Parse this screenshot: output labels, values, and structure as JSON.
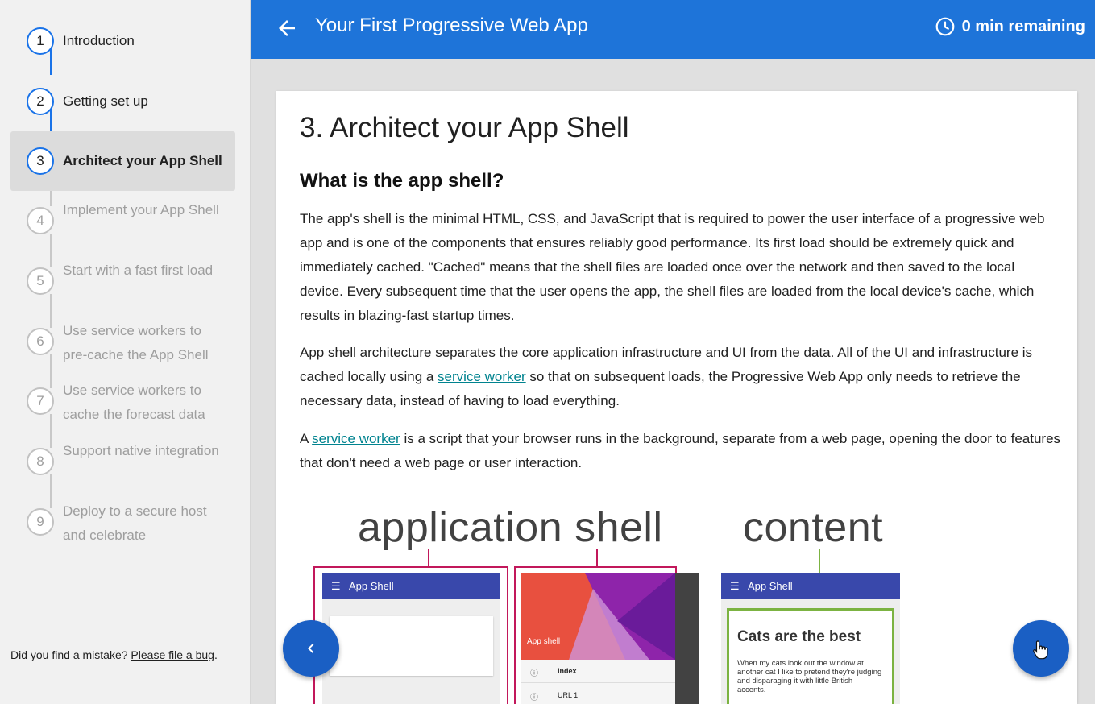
{
  "sidebar": {
    "steps": [
      {
        "num": "1",
        "label": "Introduction",
        "state": "done"
      },
      {
        "num": "2",
        "label": "Getting set up",
        "state": "done"
      },
      {
        "num": "3",
        "label": "Architect your App Shell",
        "state": "active"
      },
      {
        "num": "4",
        "label": "Implement your App Shell",
        "state": "todo"
      },
      {
        "num": "5",
        "label": "Start with a fast first load",
        "state": "todo"
      },
      {
        "num": "6",
        "label": "Use service workers to pre-cache the App Shell",
        "state": "todo"
      },
      {
        "num": "7",
        "label": "Use service workers to cache the forecast data",
        "state": "todo"
      },
      {
        "num": "8",
        "label": "Support native integration",
        "state": "todo"
      },
      {
        "num": "9",
        "label": "Deploy to a secure host and celebrate",
        "state": "todo"
      }
    ],
    "bug_prompt": "Did you find a mistake?",
    "bug_link": "Please file a bug",
    "bug_suffix": "."
  },
  "header": {
    "title": "Your First Progressive Web App",
    "time_remaining": "0 min remaining",
    "back_icon": "arrow-left-icon",
    "clock_icon": "clock-icon"
  },
  "content": {
    "title": "3. Architect your App Shell",
    "subtitle": "What is the app shell?",
    "p1": "The app's shell is the minimal HTML, CSS, and JavaScript that is required to power the user interface of a progressive web app and is one of the components that ensures reliably good performance. Its first load should be extremely quick and immediately cached. \"Cached\" means that the shell files are loaded once over the network and then saved to the local device. Every subsequent time that the user opens the app, the shell files are loaded from the local device's cache, which results in blazing-fast startup times.",
    "p2_before": "App shell architecture separates the core application infrastructure and UI from the data. All of the UI and infrastructure is cached locally using a ",
    "p2_link": "service worker",
    "p2_after": " so that on subsequent loads, the Progressive Web App only needs to retrieve the necessary data, instead of having to load everything.",
    "p3_before": "A ",
    "p3_link": "service worker",
    "p3_after": " is a script that your browser runs in the background, separate from a web page, opening the door to features that don't need a web page or user interaction."
  },
  "diagram": {
    "label_shell": "application shell",
    "label_content": "content",
    "phone1_title": "App Shell",
    "phone2_banner": "App shell",
    "phone2_item1": "Index",
    "phone2_item2": "URL 1",
    "phone3_title": "App Shell",
    "phone3_heading": "Cats are the best",
    "phone3_body": "When my cats look out the window at another cat I like to pretend they're judging and disparaging it with little British accents.",
    "colors": {
      "shell_outline": "#c2185b",
      "content_outline": "#7cb342",
      "appbar": "#3948ab"
    }
  },
  "nav": {
    "prev_icon": "chevron-left-icon",
    "next_icon": "chevron-right-icon"
  }
}
